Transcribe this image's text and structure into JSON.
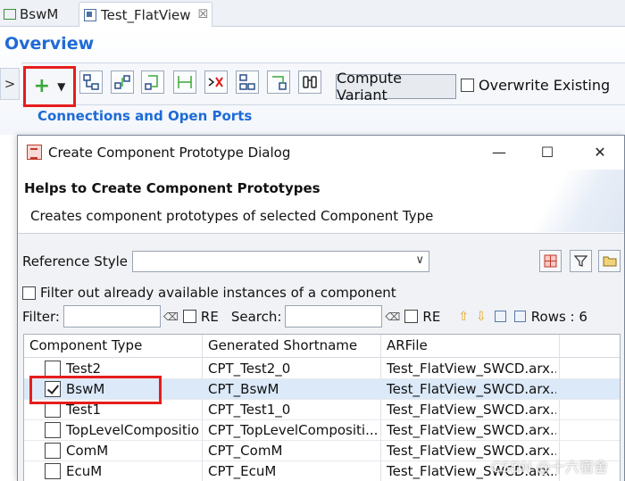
{
  "tabs": [
    {
      "label": "BswM",
      "icon": "package-icon"
    },
    {
      "label": "Test_FlatView",
      "icon": "flatview-editor-icon",
      "close": "☒"
    }
  ],
  "overview": {
    "title": "Overview",
    "sidebar_toggle": ">"
  },
  "toolbar": {
    "add_caret": "▼",
    "compute_variant_label": "Compute Variant",
    "overwrite_existing_label": "Overwrite Existing",
    "overwrite_checked": false
  },
  "section": {
    "connections_title": "Connections and Open Ports"
  },
  "dialog": {
    "title": "Create Component Prototype Dialog",
    "header_title": "Helps to Create Component Prototypes",
    "header_desc": "Creates component prototypes of selected Component Type",
    "reference_style_label": "Reference Style",
    "reference_style_value": "",
    "filter_out_label": "Filter out already available instances of a component",
    "filter_label": "Filter:",
    "search_label": "Search:",
    "re_label": "RE",
    "rows_label": "Rows : 6",
    "columns": [
      "Component Type",
      "Generated Shortname",
      "ARFile"
    ],
    "rows": [
      {
        "checked": false,
        "type": "Test2",
        "shortname": "CPT_Test2_0",
        "arfile": "Test_FlatView_SWCD.arx..."
      },
      {
        "checked": true,
        "type": "BswM",
        "shortname": "CPT_BswM",
        "arfile": "Test_FlatView_SWCD.arx..."
      },
      {
        "checked": false,
        "type": "Test1",
        "shortname": "CPT_Test1_0",
        "arfile": "Test_FlatView_SWCD.arx..."
      },
      {
        "checked": false,
        "type": "TopLevelCompositio",
        "shortname": "CPT_TopLevelCompositi...",
        "arfile": "Test_FlatView_SWCD.arx..."
      },
      {
        "checked": false,
        "type": "ComM",
        "shortname": "CPT_ComM",
        "arfile": "Test_FlatView_SWCD.arx..."
      },
      {
        "checked": false,
        "type": "EcuM",
        "shortname": "CPT_EcuM",
        "arfile": "Test_FlatView_SWCD.arx..."
      }
    ]
  },
  "watermark": "CSDN @十六宿舍",
  "colors": {
    "accent_blue": "#1e6bd6",
    "highlight_red": "#e51d1d",
    "selected_row": "#dbe9f8"
  }
}
